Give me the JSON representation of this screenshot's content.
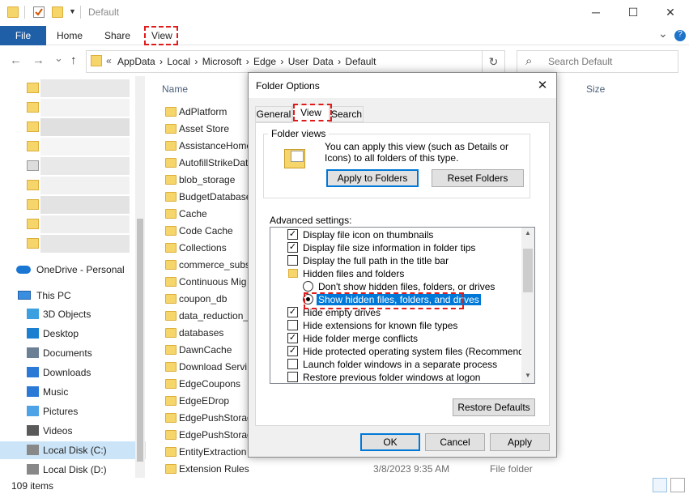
{
  "window": {
    "title": "Default",
    "controls": {
      "minimize": "─",
      "maximize": "☐",
      "close": "✕"
    }
  },
  "ribbon": {
    "tabs": [
      "File",
      "Home",
      "Share",
      "View"
    ],
    "expand_icon": "chevron-down-icon",
    "help_icon": "help-icon",
    "help_glyph": "?",
    "expand_glyph": "⌄"
  },
  "nav": {
    "back": "←",
    "forward": "→",
    "recent": "⌄",
    "up": "↑",
    "address_prefix": "«",
    "path": [
      "AppData",
      "Local",
      "Microsoft",
      "Edge",
      "User Data",
      "Default"
    ],
    "path_text": "AppData  ›  Local  ›  Microsoft  ›  Edge  ›  User Data  ›  Default",
    "refresh": "↻",
    "search_placeholder": "Search Default",
    "search_glyph": "⌕"
  },
  "sidebar": {
    "onedrive": "OneDrive - Personal",
    "this_pc": "This PC",
    "items": [
      {
        "label": "3D Objects",
        "icon": "cube-icon",
        "color": "#3aa0e0"
      },
      {
        "label": "Desktop",
        "icon": "desktop-icon",
        "color": "#1a7fd0"
      },
      {
        "label": "Documents",
        "icon": "documents-icon",
        "color": "#6b7f95"
      },
      {
        "label": "Downloads",
        "icon": "download-icon",
        "color": "#2b79d6"
      },
      {
        "label": "Music",
        "icon": "music-icon",
        "color": "#2b79d6"
      },
      {
        "label": "Pictures",
        "icon": "pictures-icon",
        "color": "#4da3e6"
      },
      {
        "label": "Videos",
        "icon": "videos-icon",
        "color": "#5a5a5a"
      },
      {
        "label": "Local Disk (C:)",
        "icon": "drive-icon",
        "color": "#888888",
        "selected": true
      },
      {
        "label": "Local Disk (D:)",
        "icon": "drive-icon",
        "color": "#888888"
      }
    ]
  },
  "filelist": {
    "columns": {
      "name": "Name",
      "size": "Size"
    },
    "rows": [
      {
        "name": "AdPlatform"
      },
      {
        "name": "Asset Store"
      },
      {
        "name": "AssistanceHome"
      },
      {
        "name": "AutofillStrikeDat"
      },
      {
        "name": "blob_storage"
      },
      {
        "name": "BudgetDatabase"
      },
      {
        "name": "Cache"
      },
      {
        "name": "Code Cache"
      },
      {
        "name": "Collections"
      },
      {
        "name": "commerce_subs"
      },
      {
        "name": "Continuous Mig"
      },
      {
        "name": "coupon_db"
      },
      {
        "name": "data_reduction_"
      },
      {
        "name": "databases"
      },
      {
        "name": "DawnCache"
      },
      {
        "name": "Download Servi"
      },
      {
        "name": "EdgeCoupons"
      },
      {
        "name": "EdgeEDrop"
      },
      {
        "name": "EdgePushStorag"
      },
      {
        "name": "EdgePushStorag"
      },
      {
        "name": "EntityExtraction"
      },
      {
        "name": "Extension Rules",
        "date": "3/8/2023 9:35 AM",
        "type": "File folder"
      }
    ]
  },
  "status": {
    "count": "109 items"
  },
  "dialog": {
    "title": "Folder Options",
    "close": "✕",
    "tabs": [
      "General",
      "View",
      "Search"
    ],
    "folder_views": {
      "legend": "Folder views",
      "description": "You can apply this view (such as Details or Icons) to all folders of this type.",
      "apply": "Apply to Folders",
      "reset": "Reset Folders"
    },
    "advanced_label": "Advanced settings:",
    "advanced": [
      {
        "kind": "check",
        "checked": true,
        "text": "Display file icon on thumbnails"
      },
      {
        "kind": "check",
        "checked": true,
        "text": "Display file size information in folder tips"
      },
      {
        "kind": "check",
        "checked": false,
        "text": "Display the full path in the title bar"
      },
      {
        "kind": "folder",
        "text": "Hidden files and folders"
      },
      {
        "kind": "radio",
        "checked": false,
        "text": "Don't show hidden files, folders, or drives"
      },
      {
        "kind": "radio",
        "checked": true,
        "text": "Show hidden files, folders, and drives"
      },
      {
        "kind": "check",
        "checked": true,
        "text": "Hide empty drives"
      },
      {
        "kind": "check",
        "checked": false,
        "text": "Hide extensions for known file types"
      },
      {
        "kind": "check",
        "checked": true,
        "text": "Hide folder merge conflicts"
      },
      {
        "kind": "check",
        "checked": true,
        "text": "Hide protected operating system files (Recommended)"
      },
      {
        "kind": "check",
        "checked": false,
        "text": "Launch folder windows in a separate process"
      },
      {
        "kind": "check",
        "checked": false,
        "text": "Restore previous folder windows at logon"
      }
    ],
    "scroll_up": "▲",
    "scroll_down": "▼",
    "check_glyph": "✓",
    "restore_defaults": "Restore Defaults",
    "ok": "OK",
    "cancel": "Cancel",
    "apply": "Apply"
  },
  "colors": {
    "accent": "#0078d7",
    "file_tab": "#1f5fa8",
    "highlight_box": "#e01b1b",
    "folder": "#f6d56b",
    "selection": "#cce4f7"
  }
}
